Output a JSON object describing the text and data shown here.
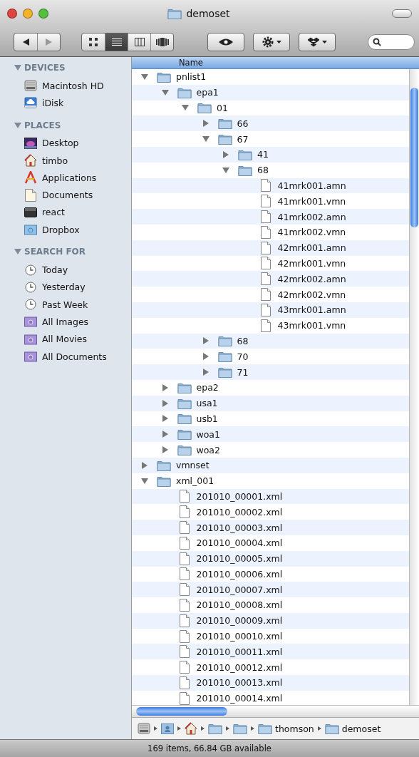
{
  "window": {
    "title": "demoset"
  },
  "toolbar": {
    "view_modes": [
      {
        "kind": "icon",
        "selected": false
      },
      {
        "kind": "list",
        "selected": true
      },
      {
        "kind": "column",
        "selected": false
      },
      {
        "kind": "coverflow",
        "selected": false
      }
    ]
  },
  "sidebar": [
    {
      "heading": "DEVICES",
      "expanded": true,
      "items": [
        {
          "kind": "disk",
          "label": "Macintosh HD"
        },
        {
          "kind": "idisk",
          "label": "iDisk"
        }
      ]
    },
    {
      "heading": "PLACES",
      "expanded": true,
      "items": [
        {
          "kind": "desktop",
          "label": "Desktop"
        },
        {
          "kind": "home",
          "label": "timbo"
        },
        {
          "kind": "apps",
          "label": "Applications"
        },
        {
          "kind": "document",
          "label": "Documents"
        },
        {
          "kind": "drive",
          "label": "react"
        },
        {
          "kind": "dropbox",
          "label": "Dropbox"
        }
      ]
    },
    {
      "heading": "SEARCH FOR",
      "expanded": true,
      "items": [
        {
          "kind": "clock",
          "label": "Today"
        },
        {
          "kind": "clock",
          "label": "Yesterday"
        },
        {
          "kind": "clock",
          "label": "Past Week"
        },
        {
          "kind": "smart",
          "label": "All Images"
        },
        {
          "kind": "smart",
          "label": "All Movies"
        },
        {
          "kind": "smart",
          "label": "All Documents"
        }
      ]
    }
  ],
  "table": {
    "columns": [
      "Name"
    ]
  },
  "tree": [
    {
      "kind": "folder",
      "name": "pnlist1",
      "expanded": true,
      "children": [
        {
          "kind": "folder",
          "name": "epa1",
          "expanded": true,
          "children": [
            {
              "kind": "folder",
              "name": "01",
              "expanded": true,
              "children": [
                {
                  "kind": "folder",
                  "name": "66",
                  "expanded": false
                },
                {
                  "kind": "folder",
                  "name": "67",
                  "expanded": true,
                  "children": [
                    {
                      "kind": "folder",
                      "name": "41",
                      "expanded": false
                    },
                    {
                      "kind": "folder",
                      "name": "68",
                      "expanded": true,
                      "children": [
                        {
                          "kind": "file",
                          "name": "41mrk001.amn"
                        },
                        {
                          "kind": "file",
                          "name": "41mrk001.vmn"
                        },
                        {
                          "kind": "file",
                          "name": "41mrk002.amn"
                        },
                        {
                          "kind": "file",
                          "name": "41mrk002.vmn"
                        },
                        {
                          "kind": "file",
                          "name": "42mrk001.amn"
                        },
                        {
                          "kind": "file",
                          "name": "42mrk001.vmn"
                        },
                        {
                          "kind": "file",
                          "name": "42mrk002.amn"
                        },
                        {
                          "kind": "file",
                          "name": "42mrk002.vmn"
                        },
                        {
                          "kind": "file",
                          "name": "43mrk001.amn"
                        },
                        {
                          "kind": "file",
                          "name": "43mrk001.vmn"
                        }
                      ]
                    }
                  ]
                },
                {
                  "kind": "folder",
                  "name": "68",
                  "expanded": false
                },
                {
                  "kind": "folder",
                  "name": "70",
                  "expanded": false
                },
                {
                  "kind": "folder",
                  "name": "71",
                  "expanded": false
                }
              ]
            }
          ]
        },
        {
          "kind": "folder",
          "name": "epa2",
          "expanded": false
        },
        {
          "kind": "folder",
          "name": "usa1",
          "expanded": false
        },
        {
          "kind": "folder",
          "name": "usb1",
          "expanded": false
        },
        {
          "kind": "folder",
          "name": "woa1",
          "expanded": false
        },
        {
          "kind": "folder",
          "name": "woa2",
          "expanded": false
        }
      ]
    },
    {
      "kind": "folder",
      "name": "vmnset",
      "expanded": false
    },
    {
      "kind": "folder",
      "name": "xml_001",
      "expanded": true,
      "children": [
        {
          "kind": "file",
          "name": "201010_00001.xml"
        },
        {
          "kind": "file",
          "name": "201010_00002.xml"
        },
        {
          "kind": "file",
          "name": "201010_00003.xml"
        },
        {
          "kind": "file",
          "name": "201010_00004.xml"
        },
        {
          "kind": "file",
          "name": "201010_00005.xml"
        },
        {
          "kind": "file",
          "name": "201010_00006.xml"
        },
        {
          "kind": "file",
          "name": "201010_00007.xml"
        },
        {
          "kind": "file",
          "name": "201010_00008.xml"
        },
        {
          "kind": "file",
          "name": "201010_00009.xml"
        },
        {
          "kind": "file",
          "name": "201010_00010.xml"
        },
        {
          "kind": "file",
          "name": "201010_00011.xml"
        },
        {
          "kind": "file",
          "name": "201010_00012.xml"
        },
        {
          "kind": "file",
          "name": "201010_00013.xml"
        },
        {
          "kind": "file",
          "name": "201010_00014.xml"
        }
      ]
    }
  ],
  "path_bar": [
    {
      "kind": "disk"
    },
    {
      "kind": "user"
    },
    {
      "kind": "home"
    },
    {
      "kind": "folder"
    },
    {
      "kind": "folder"
    },
    {
      "kind": "folder",
      "label": "thomson"
    },
    {
      "kind": "folder",
      "label": "demoset"
    }
  ],
  "status_bar": "169 items, 66.84 GB available"
}
